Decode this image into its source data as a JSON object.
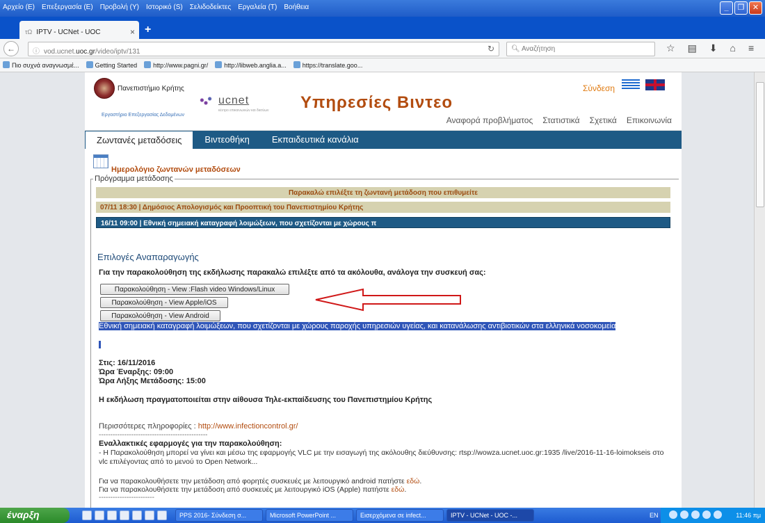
{
  "browser": {
    "menus": [
      "Αρχείο (Ε)",
      "Επεξεργασία (Ε)",
      "Προβολή (Υ)",
      "Ιστορικό (S)",
      "Σελιδοδείκτες",
      "Εργαλεία (Τ)",
      "Βοήθεια"
    ],
    "tab_title": "IPTV - UCNet - UOC",
    "tab_favicon": "τΩ",
    "new_tab": "+",
    "url_host": "vod.ucnet.",
    "url_domain": "uoc.gr",
    "url_path": "/video/iptv/131",
    "search_placeholder": "Αναζήτηση",
    "bookmarks": [
      "Πιο συχνά αναγνωσμέ...",
      "Getting Started",
      "http://www.pagni.gr/",
      "http://libweb.anglia.a...",
      "https://translate.goo..."
    ]
  },
  "site": {
    "uoc_name": "Πανεπιστήμιο Κρήτης",
    "uoc_sub": "Εργαστήριο Επεξεργασίας Δεδομένων",
    "ucnet": "ucnet",
    "ucnet_sub": "κέντρο επικοινωνιών και δικτύων",
    "title": "Υπηρεσίες Βιντεο",
    "login": "Σύνδεση",
    "toplinks": [
      "Αναφορά προβλήματος",
      "Στατιστικά",
      "Σχετικά",
      "Επικοινωνία"
    ],
    "nav": [
      "Ζωντανές μεταδόσεις",
      "Βιντεοθήκη",
      "Εκπαιδευτικά κανάλια"
    ]
  },
  "content": {
    "calendar_title": "Ημερολόγιο ζωντανών μεταδόσεων",
    "legend": "Πρόγραμμα μετάδοσης",
    "select_prompt": "Παρακαλώ επιλέξτε τη ζωντανή μετάδοση που επιθυμείτε",
    "event1": "07/11 18:30 | Δημόσιος Απολογισμός και Προοπτική του Πανεπιστημίου Κρήτης",
    "event2": "16/11 09:00 | Εθνική σημειακή καταγραφή λοιμώξεων, που σχετίζονται με χώρους π",
    "playback_title": "Επιλογές Αναπαραγωγής",
    "instruction": "Για την παρακολούθηση της εκδήλωσης παρακαλώ επιλέξτε από τα ακόλουθα, ανάλογα την συσκευή σας:",
    "buttons": [
      "Παρακολούθηση - View :Flash video Windows/Linux",
      "Παρακολούθηση - View Apple/iOS",
      "Παρακολούθηση - View Android"
    ],
    "highlight_text": "Εθνική σημειακή καταγραφή λοιμώξεων, που σχετίζονται με χώρους παροχής υπηρεσιών υγείας, και κατανάλωσης αντιβιοτικών στα ελληνικά νοσοκομεία",
    "date_line": "Στις: 16/11/2016",
    "start_line": "Ώρα Έναρξης: 09:00",
    "end_line": "Ώρα Λήξης Μετάδοσης: 15:00",
    "venue": "Η εκδήλωση πραγματοποιείται στην αίθουσα Τηλε-εκπαίδευσης του Πανεπιστημίου Κρήτης",
    "more_label": "Περισσότερες πληροφορίες :",
    "more_link": "http://www.infectioncontrol.gr/",
    "dash_line": "-----------------------------------------------",
    "alt_title": "Εναλλακτικές εφαρμογές για την παρακολούθηση:",
    "alt_text": "- Η Παρακολούθηση μπορεί να γίνει και μέσω της εφαρμογής VLC με την εισαγωγή της ακόλουθης διεύθυνσης: rtsp://wowza.ucnet.uoc.gr:1935 /live/2016-11-16-loimokseis στο vlc επιλέγοντας από το μενού το Open Network...",
    "android_text": "Για να παρακολουθήσετε την μετάδοση από φορητές συσκευές με λειτουργικό android πατήστε",
    "ios_text": "Για να παρακολουθήσετε την μετάδοση από συσκευές με λειτουργικό iOS (Apple) πατήστε",
    "here_link": "εδώ",
    "dash_line2": "------------------------"
  },
  "taskbar": {
    "start": "έναρξη",
    "tasks": [
      "PPS 2016- Σύνδεση σ...",
      "Microsoft PowerPoint ...",
      "Εισερχόμενα σε infect...",
      "IPTV - UCNet - UOC -..."
    ],
    "lang": "EN",
    "clock": "11:46 πμ"
  },
  "colors": {
    "accent": "#b24c0f",
    "nav": "#1e5a85",
    "event_bar": "#d6d2b0",
    "highlight": "#2f55b8",
    "arrow": "#d01818"
  }
}
